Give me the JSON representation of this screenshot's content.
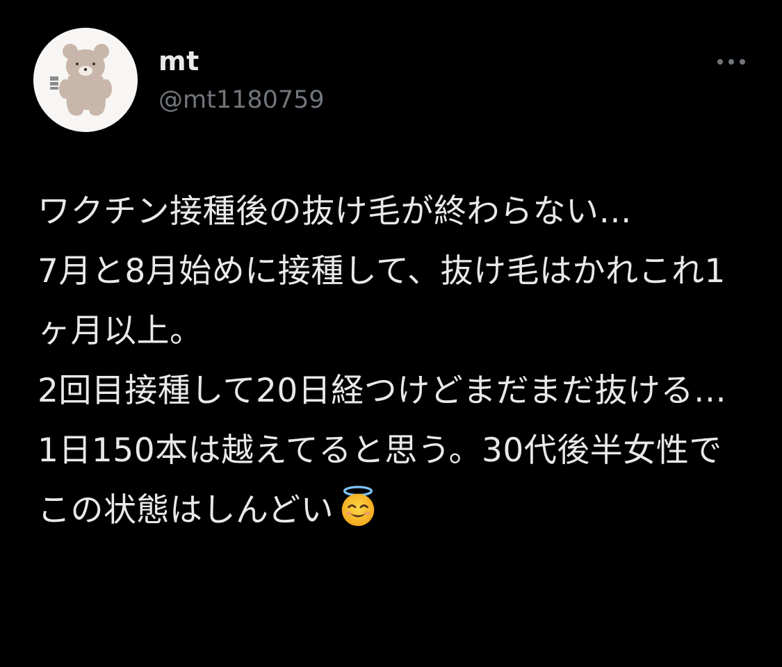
{
  "tweet": {
    "author": {
      "display_name": "mt",
      "handle": "@mt1180759",
      "avatar_icon": "bear-avatar-icon"
    },
    "more_icon": "more-options-icon",
    "text": "ワクチン接種後の抜け毛が終わらない…\n7月と8月始めに接種して、抜け毛はかれこれ1ヶ月以上。\n2回目接種して20日経つけどまだまだ抜ける…1日150本は越えてると思う。30代後半女性でこの状態はしんどい",
    "text_emoji": "smiling-face-with-halo-icon"
  },
  "colors": {
    "background": "#000000",
    "text_primary": "#e7e9ea",
    "text_secondary": "#71767b"
  }
}
